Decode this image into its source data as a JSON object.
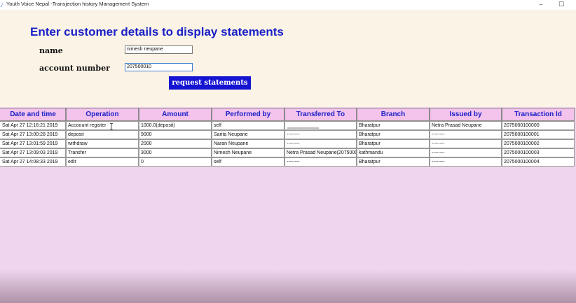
{
  "window": {
    "title": "Youth Voice Nepal -Transjection history Management System",
    "min_glyph": "–",
    "max_glyph": "☐",
    "app_icon": "feather-icon"
  },
  "form": {
    "heading": "Enter customer details to display statements",
    "name_label": "name",
    "name_value": "nimesh neupane",
    "account_label": "account number",
    "account_value": "207500010",
    "request_button": "request statements"
  },
  "table": {
    "headers": [
      "Date and time",
      "Operation",
      "Amount",
      "Performed by",
      "Transferred To",
      "Branch",
      "Issued by",
      "Transaction Id"
    ],
    "rows": [
      [
        "Sat Apr 27 12:16:21 2019",
        "Accoount register",
        "1000.0(deposit)",
        "self",
        "",
        "Bharatpur",
        "Netra Prasad Neupane",
        "2075000100000"
      ],
      [
        "Sat Apr 27 13:00:28 2019",
        "deposit",
        "9000",
        "Sarita Neupane",
        "--------",
        "Bharatpur",
        "--------",
        "2075000100001"
      ],
      [
        "Sat Apr 27 13:01:59 2019",
        "withdraw",
        "2000",
        "Naran Neupane",
        "--------",
        "Bharatpur",
        "--------",
        "2075000100002"
      ],
      [
        "Sat Apr 27 13:09:03 2019",
        "Transfer",
        "3000",
        "Nimesh Neupane",
        "Netra Prasad Neupane(2075000",
        "kathmandu",
        "--------",
        "2075000100003"
      ],
      [
        "Sat Apr 27 14:08:33 2019",
        "edit",
        "0",
        "self",
        "--------",
        "Bharatpur",
        "--------",
        "2075000100004"
      ]
    ]
  },
  "colors": {
    "heading": "#1a20c8",
    "button": "#1414d2",
    "header_bg": "#f3c3ec",
    "form_bg": "#fbf3e5",
    "page_bg": "#efd6ee"
  }
}
